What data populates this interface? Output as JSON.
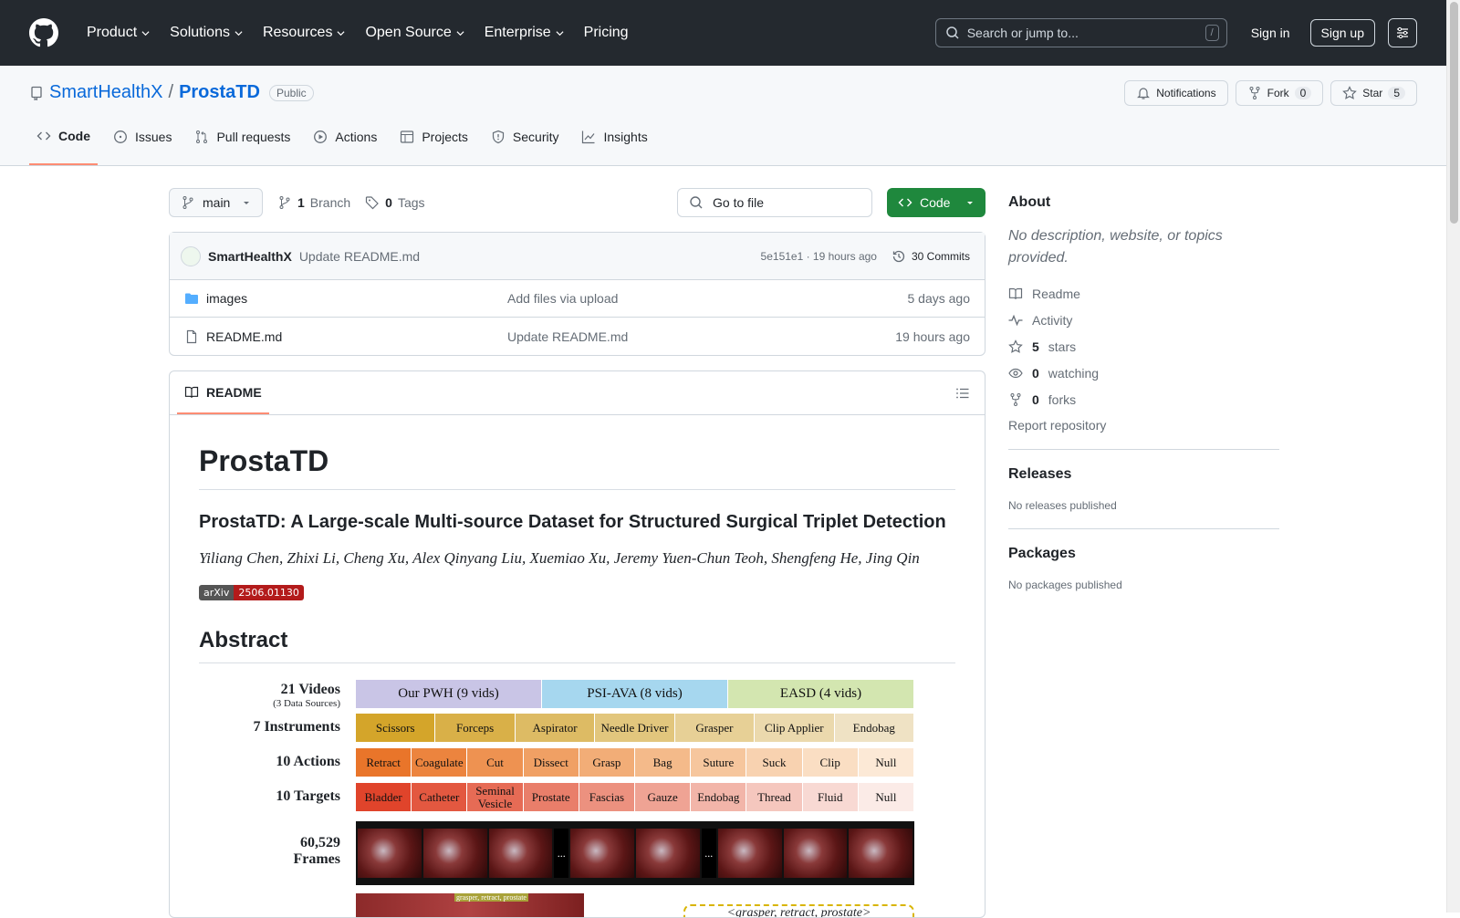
{
  "header": {
    "nav": [
      "Product",
      "Solutions",
      "Resources",
      "Open Source",
      "Enterprise",
      "Pricing"
    ],
    "search_placeholder": "Search or jump to...",
    "search_shortcut": "/",
    "sign_in": "Sign in",
    "sign_up": "Sign up"
  },
  "repo": {
    "owner": "SmartHealthX",
    "separator": "/",
    "name": "ProstaTD",
    "visibility": "Public",
    "notifications_label": "Notifications",
    "fork_label": "Fork",
    "fork_count": "0",
    "star_label": "Star",
    "star_count": "5",
    "tabs": [
      "Code",
      "Issues",
      "Pull requests",
      "Actions",
      "Projects",
      "Security",
      "Insights"
    ]
  },
  "toolbar": {
    "branch": "main",
    "branch_count": "1",
    "branch_label": "Branch",
    "tag_count": "0",
    "tag_label": "Tags",
    "go_to_file": "Go to file",
    "code_button": "Code"
  },
  "commit": {
    "author": "SmartHealthX",
    "message": "Update README.md",
    "sha_time": "5e151e1 · 19 hours ago",
    "commits": "30 Commits"
  },
  "files": [
    {
      "name": "images",
      "type": "folder",
      "message": "Add files via upload",
      "date": "5 days ago"
    },
    {
      "name": "README.md",
      "type": "file",
      "message": "Update README.md",
      "date": "19 hours ago"
    }
  ],
  "readme": {
    "tab": "README",
    "title": "ProstaTD",
    "subtitle": "ProstaTD: A Large-scale Multi-source Dataset for Structured Surgical Triplet Detection",
    "authors": "Yiliang Chen, Zhixi Li, Cheng Xu, Alex Qinyang Liu, Xuemiao Xu, Jeremy Yuen-Chun Teoh, Shengfeng He, Jing Qin",
    "badge_left": "arXiv",
    "badge_right": "2506.01130",
    "abstract_heading": "Abstract",
    "figure": {
      "videos_label": "21 Videos",
      "videos_sub": "(3 Data Sources)",
      "instruments_label": "7 Instruments",
      "actions_label": "10 Actions",
      "targets_label": "10 Targets",
      "frames_label_1": "60,529",
      "frames_label_2": "Frames",
      "sources": [
        {
          "label": "Our PWH (9 vids)",
          "color": "#c9c5e6"
        },
        {
          "label": "PSI-AVA (8 vids)",
          "color": "#a6d7ef"
        },
        {
          "label": "EASD (4 vids)",
          "color": "#d3e6b0"
        }
      ],
      "instruments": [
        "Scissors",
        "Forceps",
        "Aspirator",
        "Needle Driver",
        "Grasper",
        "Clip Applier",
        "Endobag"
      ],
      "instrument_colors": [
        "#d4a52a",
        "#d9b048",
        "#ddbb64",
        "#e2c67d",
        "#e7d096",
        "#ebd9ad",
        "#efe2c4"
      ],
      "actions": [
        "Retract",
        "Coagulate",
        "Cut",
        "Dissect",
        "Grasp",
        "Bag",
        "Suture",
        "Suck",
        "Clip",
        "Null"
      ],
      "action_colors": [
        "#e9752a",
        "#ec843e",
        "#ee9251",
        "#f0a064",
        "#f2ad77",
        "#f4ba8a",
        "#f6c69d",
        "#f8d2b0",
        "#fadec3",
        "#fce9d6"
      ],
      "targets": [
        "Bladder",
        "Catheter",
        "Seminal Vesicle",
        "Prostate",
        "Fascias",
        "Gauze",
        "Endobag",
        "Thread",
        "Fluid",
        "Null"
      ],
      "target_colors": [
        "#e0442b",
        "#e35840",
        "#e66b55",
        "#e97e6a",
        "#ec917f",
        "#efa394",
        "#f2b5a9",
        "#f5c7be",
        "#f8d9d3",
        "#fbebe7"
      ],
      "dots": "...",
      "frame_label": "grasper, retract, prostate",
      "triplet": "<grasper, retract, prostate>"
    }
  },
  "sidebar": {
    "about_heading": "About",
    "description": "No description, website, or topics provided.",
    "readme": "Readme",
    "activity": "Activity",
    "stars_count": "5",
    "stars_label": "stars",
    "watching_count": "0",
    "watching_label": "watching",
    "forks_count": "0",
    "forks_label": "forks",
    "report": "Report repository",
    "releases_heading": "Releases",
    "releases_text": "No releases published",
    "packages_heading": "Packages",
    "packages_text": "No packages published"
  }
}
